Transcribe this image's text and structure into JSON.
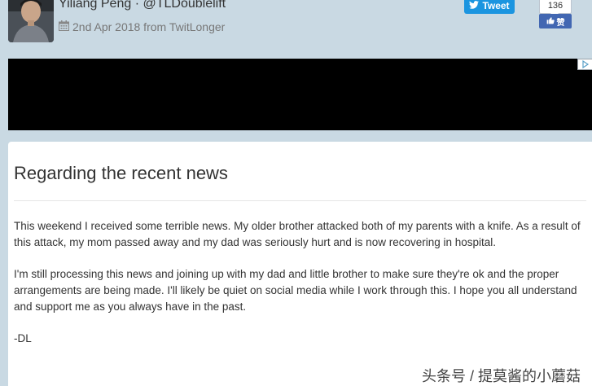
{
  "header": {
    "author": "Yiliang Peng · @TLDoublelift",
    "date_source": "2nd Apr 2018 from TwitLonger",
    "calendar_icon": "calendar-icon"
  },
  "share": {
    "tweet_label": "Tweet",
    "tweet_icon": "twitter-bird-icon",
    "like_count": "136",
    "like_label": "赞",
    "like_icon": "thumbs-up-icon"
  },
  "colors": {
    "page_bg": "#c9d9e3",
    "twitter_blue": "#1b95e0",
    "facebook_blue": "#4267b2",
    "video_bg": "#000000"
  },
  "post": {
    "title": "Regarding the recent news",
    "paragraphs": [
      "This weekend I received some terrible news. My older brother attacked both of my parents with a knife. As a result of this attack, my mom passed away and my dad was seriously hurt and is now recovering in hospital.",
      "I'm still processing this news and joining up with my dad and little brother to make sure they're ok and the proper arrangements are being made. I'll likely be quiet on social media while I work through this. I hope you all understand and support me as you always have in the past.",
      "-DL"
    ]
  },
  "watermark": {
    "text": "头条号 / 提莫酱的小蘑菇"
  }
}
